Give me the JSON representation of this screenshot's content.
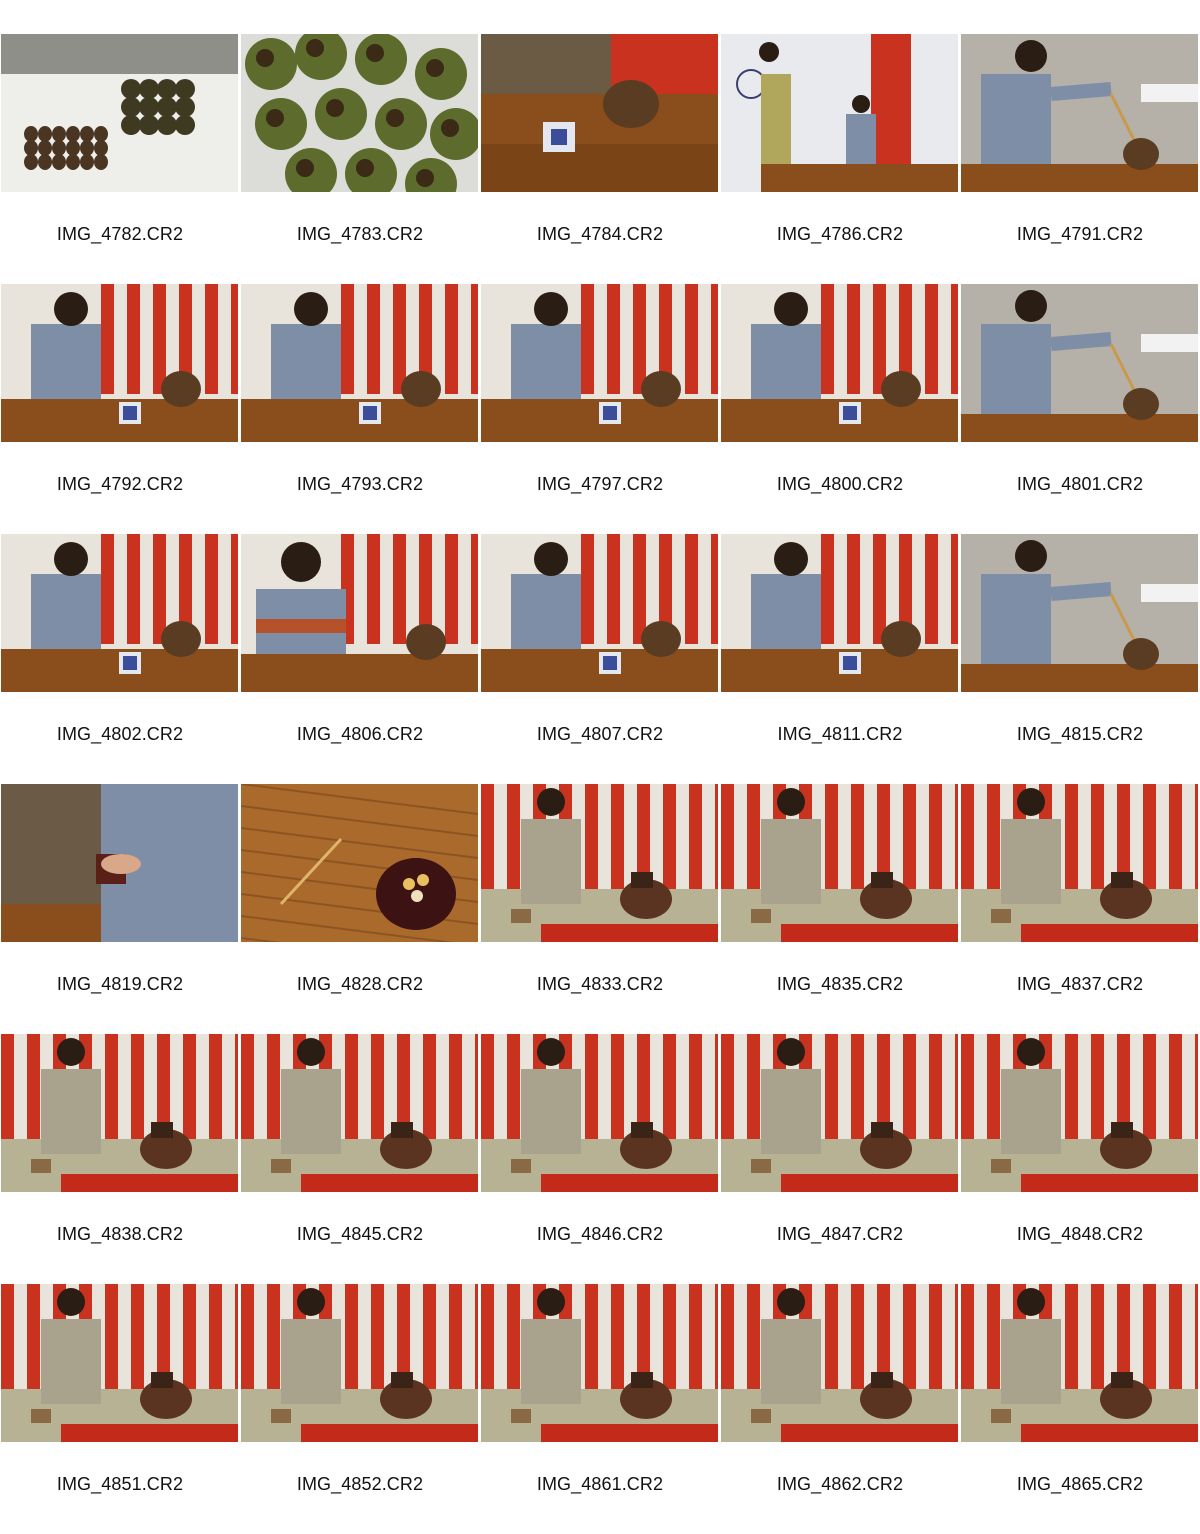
{
  "contact_sheet": {
    "thumbnails": [
      {
        "file": "IMG_4782.CR2",
        "scene": "seeds"
      },
      {
        "file": "IMG_4783.CR2",
        "scene": "pods"
      },
      {
        "file": "IMG_4784.CR2",
        "scene": "table"
      },
      {
        "file": "IMG_4786.CR2",
        "scene": "two-women"
      },
      {
        "file": "IMG_4791.CR2",
        "scene": "reach"
      },
      {
        "file": "IMG_4792.CR2",
        "scene": "seated"
      },
      {
        "file": "IMG_4793.CR2",
        "scene": "seated"
      },
      {
        "file": "IMG_4797.CR2",
        "scene": "seated"
      },
      {
        "file": "IMG_4800.CR2",
        "scene": "seated"
      },
      {
        "file": "IMG_4801.CR2",
        "scene": "reach"
      },
      {
        "file": "IMG_4802.CR2",
        "scene": "seated"
      },
      {
        "file": "IMG_4806.CR2",
        "scene": "seated-front"
      },
      {
        "file": "IMG_4807.CR2",
        "scene": "seated"
      },
      {
        "file": "IMG_4811.CR2",
        "scene": "seated"
      },
      {
        "file": "IMG_4815.CR2",
        "scene": "reach"
      },
      {
        "file": "IMG_4819.CR2",
        "scene": "hands"
      },
      {
        "file": "IMG_4828.CR2",
        "scene": "caddy"
      },
      {
        "file": "IMG_4833.CR2",
        "scene": "floor"
      },
      {
        "file": "IMG_4835.CR2",
        "scene": "floor"
      },
      {
        "file": "IMG_4837.CR2",
        "scene": "floor"
      },
      {
        "file": "IMG_4838.CR2",
        "scene": "floor"
      },
      {
        "file": "IMG_4845.CR2",
        "scene": "floor"
      },
      {
        "file": "IMG_4846.CR2",
        "scene": "floor"
      },
      {
        "file": "IMG_4847.CR2",
        "scene": "floor"
      },
      {
        "file": "IMG_4848.CR2",
        "scene": "floor"
      },
      {
        "file": "IMG_4851.CR2",
        "scene": "floor"
      },
      {
        "file": "IMG_4852.CR2",
        "scene": "floor"
      },
      {
        "file": "IMG_4861.CR2",
        "scene": "floor"
      },
      {
        "file": "IMG_4862.CR2",
        "scene": "floor"
      },
      {
        "file": "IMG_4865.CR2",
        "scene": "floor"
      }
    ]
  },
  "colors": {
    "red_curtain": "#c8321e",
    "white_curtain": "#e8e4dc",
    "wood_table": "#8a4e1c",
    "kimono_blue": "#7e8ea6",
    "kimono_grey": "#a9a38e",
    "tatami": "#b8b294",
    "red_felt": "#c42a1a"
  }
}
